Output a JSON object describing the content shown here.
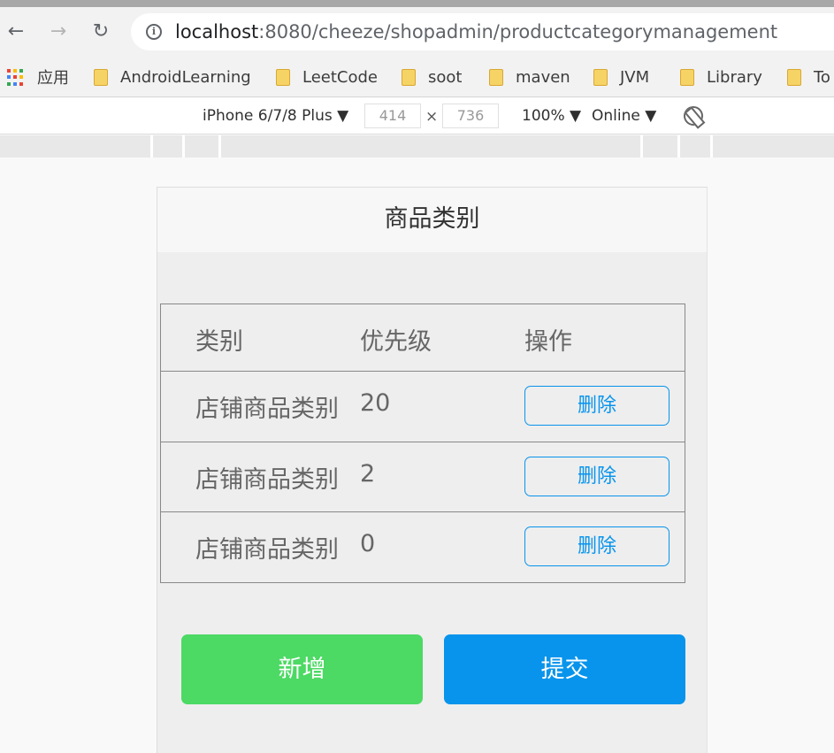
{
  "browser": {
    "url_host": "localhost",
    "url_rest": ":8080/cheeze/shopadmin/productcategorymanagement",
    "nav": {
      "back": "←",
      "forward": "→",
      "reload": "↻"
    },
    "info_icon": "i"
  },
  "bookmarks": {
    "apps_label": "应用",
    "items": [
      "AndroidLearning",
      "LeetCode",
      "soot",
      "maven",
      "JVM",
      "Library",
      "To"
    ]
  },
  "device_toolbar": {
    "device": "iPhone 6/7/8 Plus ▼",
    "width": "414",
    "times": "×",
    "height": "736",
    "zoom": "100% ▼",
    "network": "Online ▼"
  },
  "page": {
    "title": "商品类别",
    "table": {
      "headers": [
        "类别",
        "优先级",
        "操作"
      ],
      "rows": [
        {
          "name": "店铺商品类别",
          "priority": "20",
          "action": "删除"
        },
        {
          "name": "店铺商品类别",
          "priority": "2",
          "action": "删除"
        },
        {
          "name": "店铺商品类别",
          "priority": "0",
          "action": "删除"
        }
      ]
    },
    "buttons": {
      "add": "新增",
      "submit": "提交"
    }
  },
  "colors": {
    "primary": "#0894ec",
    "success": "#4cd964",
    "text": "#666666"
  }
}
